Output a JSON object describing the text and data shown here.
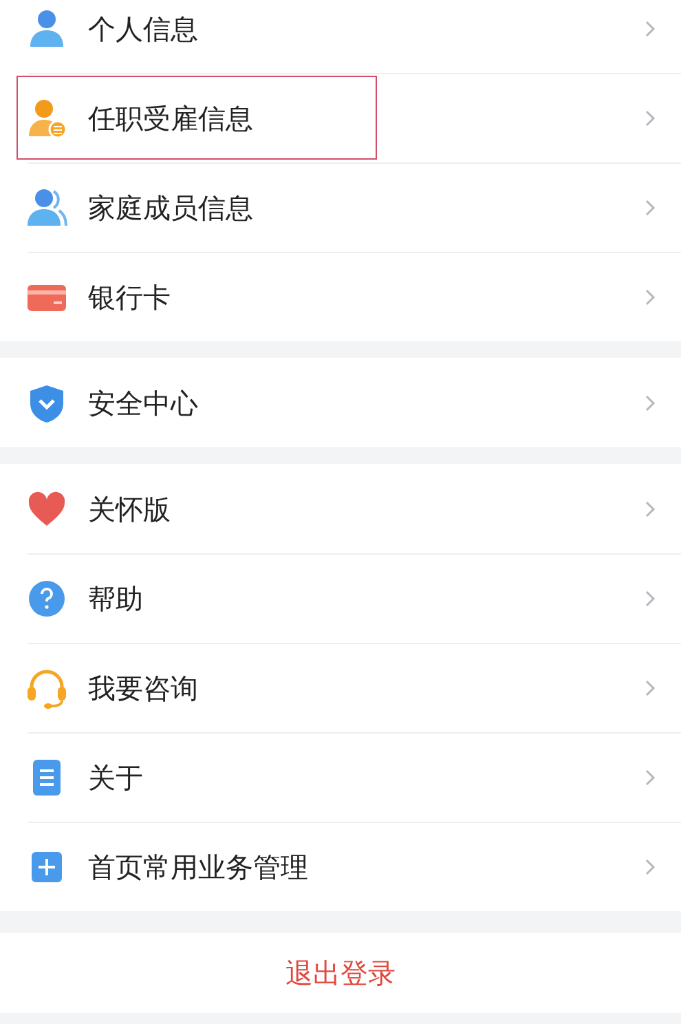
{
  "groups": [
    {
      "items": [
        {
          "label": "个人信息",
          "highlighted": false
        },
        {
          "label": "任职受雇信息",
          "highlighted": true
        },
        {
          "label": "家庭成员信息",
          "highlighted": false
        },
        {
          "label": "银行卡",
          "highlighted": false
        }
      ]
    },
    {
      "items": [
        {
          "label": "安全中心",
          "highlighted": false
        }
      ]
    },
    {
      "items": [
        {
          "label": "关怀版",
          "highlighted": false
        },
        {
          "label": "帮助",
          "highlighted": false
        },
        {
          "label": "我要咨询",
          "highlighted": false
        },
        {
          "label": "关于",
          "highlighted": false
        },
        {
          "label": "首页常用业务管理",
          "highlighted": false
        }
      ]
    }
  ],
  "logout_button": "退出登录"
}
